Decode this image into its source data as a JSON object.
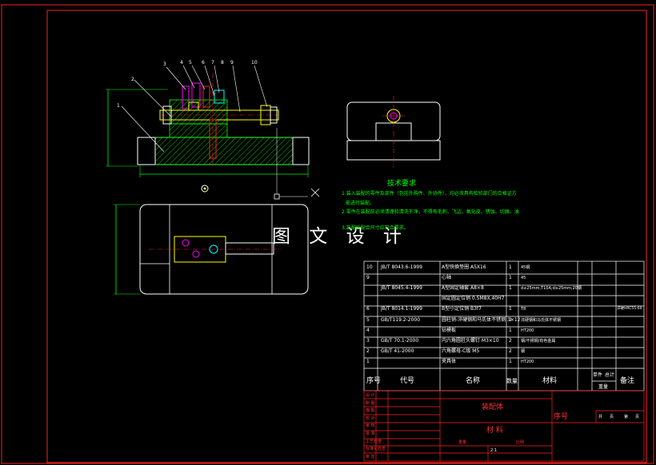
{
  "watermark": "图 文 设 计",
  "tech_requirements": {
    "title": "技术要求",
    "lines": [
      "1.装入装配的零件及部件（包括外购件、外协件），均必须具有检验部门的合格证方",
      "能进行装配。",
      "2.零件在装配前必须清理和清洗干净，不得有毛刺、飞边、氧化皮、锈蚀、切屑、油",
      "",
      "3.装配后配合尺寸应符合要求。"
    ]
  },
  "bom": {
    "rows": [
      {
        "no": "10",
        "code": "JB/T 8043.6-1999",
        "name": "A型快换垫圈 A5X16",
        "qty": "1",
        "material": "45钢",
        "note": ""
      },
      {
        "no": "9",
        "code": "",
        "name": "心轴",
        "qty": "1",
        "material": "45",
        "note": ""
      },
      {
        "no": "",
        "code": "JB/T 8045.4-1999",
        "name": "A型固定轴套 A8×8",
        "qty": "1",
        "material": "d≤25mm,T10A;d≥25mm,20钢",
        "note": ""
      },
      {
        "no": "",
        "code": "",
        "name": "固定圆定位销 0.5M8X,40H7",
        "qty": "",
        "material": "",
        "note": ""
      },
      {
        "no": "6",
        "code": "JB/T 8014.1-1999",
        "name": "B型小定位销 B3f7",
        "qty": "1",
        "material": "T8",
        "note": "淬硬HRC55-60"
      },
      {
        "no": "5",
        "code": "GB/T119.2-2000",
        "name": "圆柱销-淬硬钢和马氏体不锈钢 3×12",
        "qty": "2",
        "material": "淬硬钢和马氏体不锈钢",
        "note": ""
      },
      {
        "no": "4",
        "code": "",
        "name": "钻模板",
        "qty": "1",
        "material": "HT200",
        "note": ""
      },
      {
        "no": "3",
        "code": "GB/T 70.1-2000",
        "name": "内六角圆柱头螺钉 M3×10",
        "qty": "2",
        "material": "钢/不锈钢/有色金属",
        "note": ""
      },
      {
        "no": "2",
        "code": "GB/T 41-2000",
        "name": "六角螺母-C级 M5",
        "qty": "2",
        "material": "钢",
        "note": ""
      },
      {
        "no": "1",
        "code": "",
        "name": "夹具体",
        "qty": "1",
        "material": "HT200",
        "note": ""
      }
    ],
    "headers": {
      "no": "序号",
      "code": "代号",
      "name": "名称",
      "qty": "数量",
      "material": "材料",
      "unit_weight": "单件",
      "total_weight": "总计",
      "weight": "重量",
      "note": "备注"
    }
  },
  "title_block": {
    "drawing_name": "装配体",
    "material_label": "材 料",
    "serial_label": "序号",
    "left_labels": [
      "设 计",
      "制 图",
      "描 图",
      "校 对",
      "审 核",
      "批 准",
      "工艺检查",
      "标准化检查",
      "审 定"
    ],
    "right_labels": [
      "共",
      "页",
      "第",
      "页"
    ],
    "bottom_labels": [
      "重量",
      "比例"
    ],
    "scale": "2:1"
  },
  "callouts": [
    "1",
    "2",
    "3",
    "4",
    "5",
    "6",
    "7",
    "8",
    "9",
    "10"
  ],
  "colors": {
    "frame": "#ff2020",
    "drawing": "#ffffff",
    "hatch": "#00ff00",
    "dim": "#00ff00",
    "part_yellow": "#ffff00",
    "part_cyan": "#00ffff",
    "part_red": "#ff2020",
    "part_magenta": "#ff00ff"
  }
}
